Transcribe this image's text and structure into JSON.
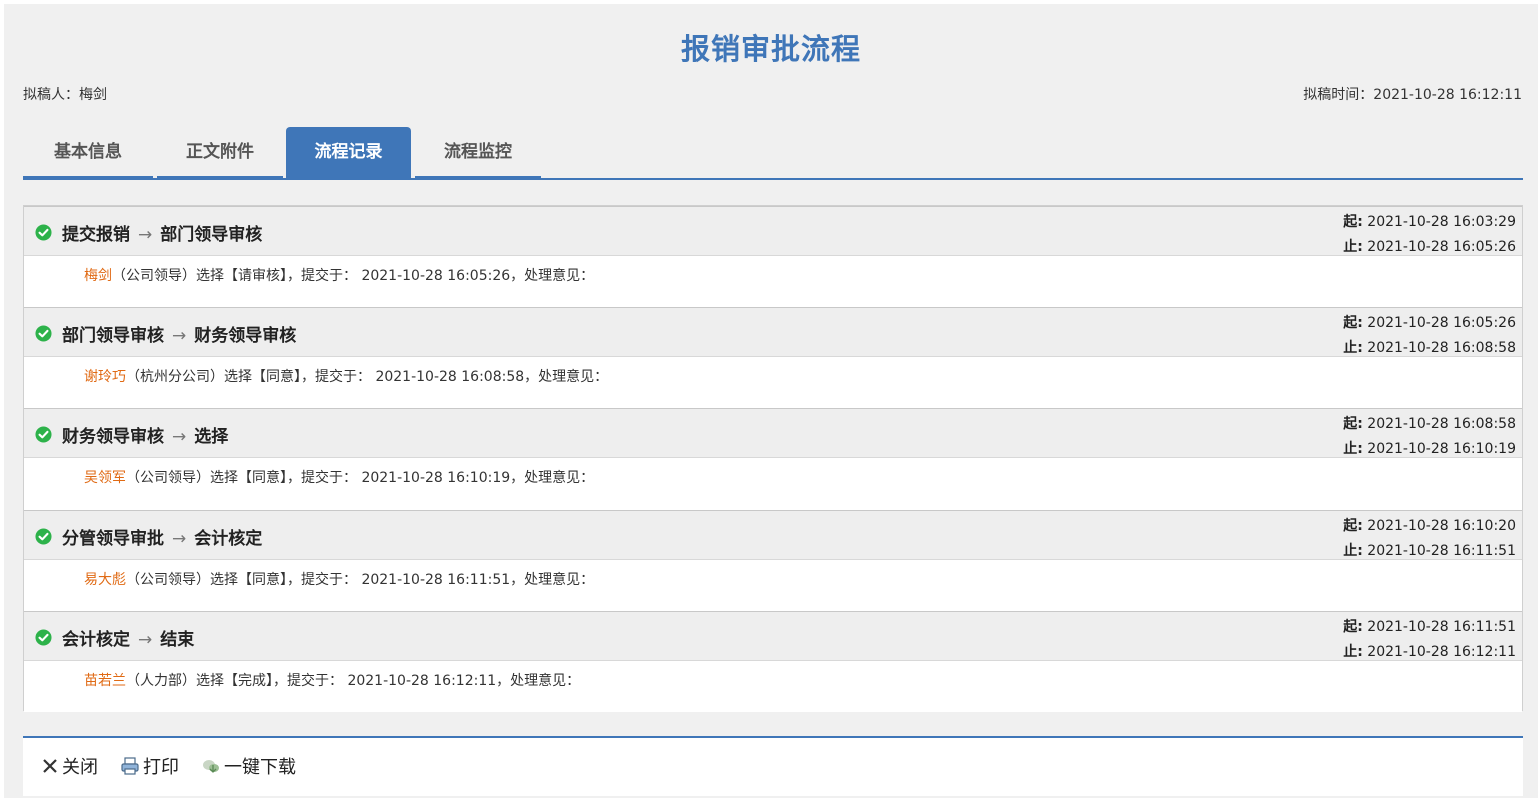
{
  "header": {
    "title": "报销审批流程",
    "drafter": "拟稿人：梅剑",
    "draft_time": "拟稿时间：2021-10-28 16:12:11"
  },
  "tabs": [
    {
      "label": "基本信息",
      "active": false
    },
    {
      "label": "正文附件",
      "active": false
    },
    {
      "label": "流程记录",
      "active": true
    },
    {
      "label": "流程监控",
      "active": false
    }
  ],
  "labels": {
    "start": "起:",
    "end": "止:",
    "arrow": "→"
  },
  "records": [
    {
      "from": "提交报销",
      "to": "部门领导审核",
      "start": "2021-10-28 16:03:29",
      "end": "2021-10-28 16:05:26",
      "handler": "梅剑",
      "detail": "（公司领导）选择【请审核】，提交于： 2021-10-28 16:05:26，处理意见："
    },
    {
      "from": "部门领导审核",
      "to": "财务领导审核",
      "start": "2021-10-28 16:05:26",
      "end": "2021-10-28 16:08:58",
      "handler": "谢玲巧",
      "detail": "（杭州分公司）选择【同意】，提交于： 2021-10-28 16:08:58，处理意见："
    },
    {
      "from": "财务领导审核",
      "to": "选择",
      "start": "2021-10-28 16:08:58",
      "end": "2021-10-28 16:10:19",
      "handler": "吴领军",
      "detail": "（公司领导）选择【同意】，提交于： 2021-10-28 16:10:19，处理意见："
    },
    {
      "from": "分管领导审批",
      "to": "会计核定",
      "start": "2021-10-28 16:10:20",
      "end": "2021-10-28 16:11:51",
      "handler": "易大彪",
      "detail": "（公司领导）选择【同意】，提交于： 2021-10-28 16:11:51，处理意见："
    },
    {
      "from": "会计核定",
      "to": "结束",
      "start": "2021-10-28 16:11:51",
      "end": "2021-10-28 16:12:11",
      "handler": "苗若兰",
      "detail": "（人力部）选择【完成】，提交于： 2021-10-28 16:12:11，处理意见："
    }
  ],
  "footer": {
    "close_label": "关闭",
    "print_label": "打印",
    "download_label": "一键下载"
  },
  "colors": {
    "accent": "#3f76b8",
    "handler": "#e06a14",
    "check": "#2db24a"
  }
}
